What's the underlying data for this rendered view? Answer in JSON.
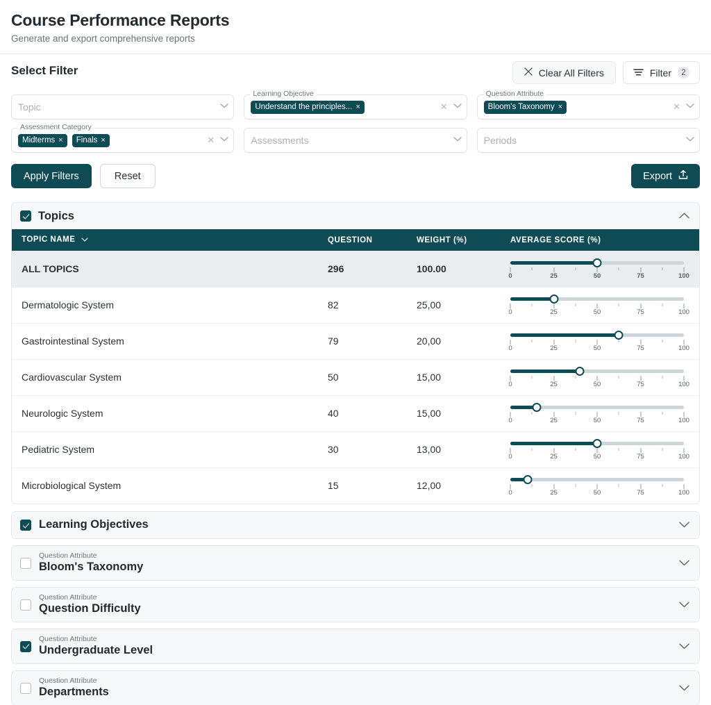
{
  "header": {
    "title": "Course Performance Reports",
    "subtitle": "Generate and export comprehensive reports"
  },
  "filter_section": {
    "heading": "Select Filter",
    "clear_all_label": "Clear All Filters",
    "filter_label": "Filter",
    "filter_count": "2",
    "clear_icon": "close-x-icon",
    "filter_icon": "filter-lines-icon"
  },
  "selects": [
    {
      "name": "topic",
      "legend": "",
      "placeholder": "Topic",
      "chips": [],
      "has_clear": false
    },
    {
      "name": "learning-objective",
      "legend": "Learning Objective",
      "placeholder": "",
      "chips": [
        "Understand the principles..."
      ],
      "has_clear": true
    },
    {
      "name": "question-attribute",
      "legend": "Question Attribute",
      "placeholder": "",
      "chips": [
        "Bloom's Taxonomy"
      ],
      "has_clear": true
    },
    {
      "name": "assessment-category",
      "legend": "Assessment Category",
      "placeholder": "",
      "chips": [
        "Midterms",
        "Finals"
      ],
      "has_clear": true
    },
    {
      "name": "assessments",
      "legend": "",
      "placeholder": "Assessments",
      "chips": [],
      "has_clear": false
    },
    {
      "name": "periods",
      "legend": "",
      "placeholder": "Periods",
      "chips": [],
      "has_clear": false
    }
  ],
  "chip_remove_glyph": "×",
  "actions": {
    "apply_label": "Apply Filters",
    "reset_label": "Reset",
    "export_label": "Export",
    "export_icon": "upload-icon"
  },
  "topics_panel": {
    "title": "Topics",
    "checked": true,
    "expanded": true,
    "chevron": "chevron-up-icon",
    "columns": [
      "TOPIC NAME",
      "QUESTION",
      "WEIGHT (%)",
      "AVERAGE SCORE (%)"
    ],
    "sort_icon": "chevron-down-icon"
  },
  "chart_data": {
    "type": "bar",
    "title": "Average Score (%) by Topic",
    "xlabel": "Average Score (%)",
    "ylabel": "Topic",
    "ylim": [
      0,
      100
    ],
    "tick_labels": [
      "0",
      "25",
      "50",
      "75",
      "100"
    ],
    "tick_values": [
      0,
      12.5,
      25,
      37.5,
      50,
      62.5,
      75,
      87.5,
      100
    ],
    "categories": [
      "ALL TOPICS",
      "Dermatologic System",
      "Gastrointestinal System",
      "Cardiovascular System",
      "Neurologic System",
      "Pediatric System",
      "Microbiological System"
    ],
    "values": [
      50,
      25,
      62.5,
      40,
      15,
      50,
      10
    ]
  },
  "topics_rows": [
    {
      "name": "ALL TOPICS",
      "question": "296",
      "weight": "100.00",
      "score": 50,
      "is_total": true
    },
    {
      "name": "Dermatologic System",
      "question": "82",
      "weight": "25,00",
      "score": 25,
      "is_total": false
    },
    {
      "name": "Gastrointestinal System",
      "question": "79",
      "weight": "20,00",
      "score": 62.5,
      "is_total": false
    },
    {
      "name": "Cardiovascular System",
      "question": "50",
      "weight": "15,00",
      "score": 40,
      "is_total": false
    },
    {
      "name": "Neurologic System",
      "question": "40",
      "weight": "15,00",
      "score": 15,
      "is_total": false
    },
    {
      "name": "Pediatric System",
      "question": "30",
      "weight": "13,00",
      "score": 50,
      "is_total": false
    },
    {
      "name": "Microbiological System",
      "question": "15",
      "weight": "12,00",
      "score": 10,
      "is_total": false
    }
  ],
  "accordions": [
    {
      "eyebrow": "",
      "title": "Learning Objectives",
      "checked": true,
      "chevron": "chevron-down-icon"
    },
    {
      "eyebrow": "Question Attribute",
      "title": "Bloom's Taxonomy",
      "checked": false,
      "chevron": "chevron-down-icon"
    },
    {
      "eyebrow": "Question Attribute",
      "title": "Question Difficulty",
      "checked": false,
      "chevron": "chevron-down-icon"
    },
    {
      "eyebrow": "Question Attribute",
      "title": "Undergraduate Level",
      "checked": true,
      "chevron": "chevron-down-icon"
    },
    {
      "eyebrow": "Question Attribute",
      "title": "Departments",
      "checked": false,
      "chevron": "chevron-down-icon"
    }
  ],
  "colors": {
    "accent": "#0e4b55",
    "panel_bg": "#f7f8f9",
    "row_total_bg": "#e9edef",
    "border": "#e4e8eb",
    "track": "#ccd5d8"
  }
}
